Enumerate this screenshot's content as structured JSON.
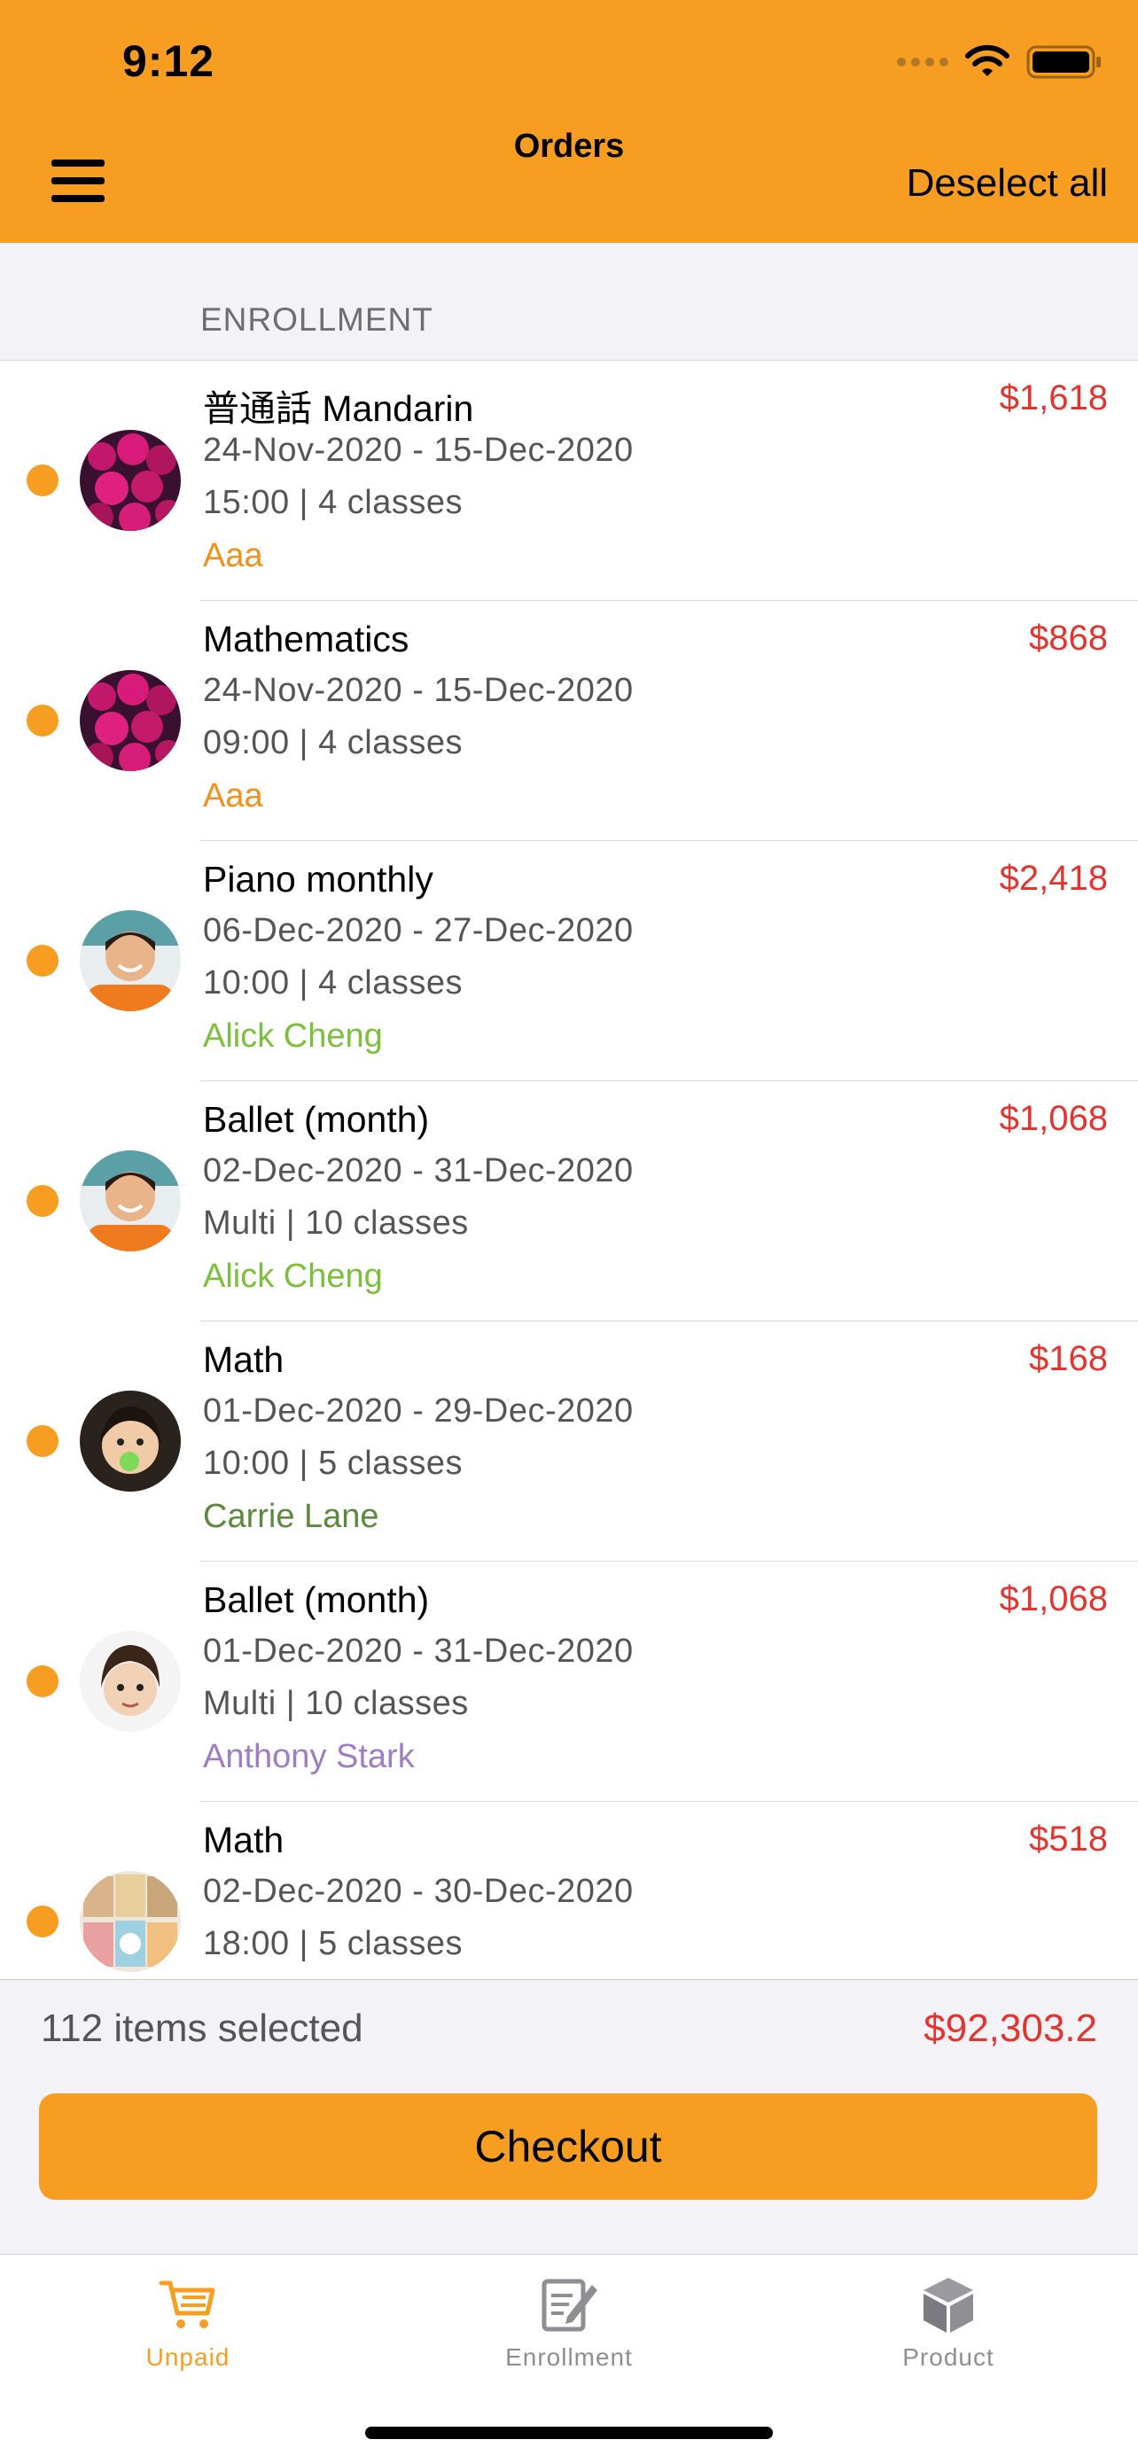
{
  "status_bar": {
    "time": "9:12"
  },
  "nav": {
    "title": "Orders",
    "deselect_label": "Deselect all"
  },
  "section": {
    "title": "ENROLLMENT"
  },
  "orders": [
    {
      "title": "普通話 Mandarin",
      "price": "$1,618",
      "dates": "24-Nov-2020  -  15-Dec-2020",
      "schedule": "15:00  |  4 classes",
      "student": "Aaa",
      "student_color": "#f0901e"
    },
    {
      "title": "Mathematics",
      "price": "$868",
      "dates": "24-Nov-2020  -  15-Dec-2020",
      "schedule": "09:00  |  4 classes",
      "student": "Aaa",
      "student_color": "#f0901e"
    },
    {
      "title": "Piano monthly",
      "price": "$2,418",
      "dates": "06-Dec-2020  -  27-Dec-2020",
      "schedule": "10:00  |  4 classes",
      "student": "Alick Cheng",
      "student_color": "#7bbf3a"
    },
    {
      "title": "Ballet (month)",
      "price": "$1,068",
      "dates": "02-Dec-2020  -  31-Dec-2020",
      "schedule": "Multi  |  10 classes",
      "student": "Alick Cheng",
      "student_color": "#7bbf3a"
    },
    {
      "title": "Math",
      "price": "$168",
      "dates": "01-Dec-2020  -  29-Dec-2020",
      "schedule": "10:00  |  5 classes",
      "student": "Carrie Lane",
      "student_color": "#5c8a3c"
    },
    {
      "title": "Ballet (month)",
      "price": "$1,068",
      "dates": "01-Dec-2020  -  31-Dec-2020",
      "schedule": "Multi  |  10 classes",
      "student": "Anthony Stark",
      "student_color": "#a07cc0"
    },
    {
      "title": "Math",
      "price": "$518",
      "dates": "02-Dec-2020  -  30-Dec-2020",
      "schedule": "18:00  |  5 classes",
      "student": "",
      "student_color": "#555555"
    }
  ],
  "summary": {
    "selected": "112 items selected",
    "total": "$92,303.2",
    "checkout_label": "Checkout"
  },
  "tabs": [
    {
      "label": "Unpaid",
      "icon": "cart-icon",
      "active": true
    },
    {
      "label": "Enrollment",
      "icon": "edit-document-icon",
      "active": false
    },
    {
      "label": "Product",
      "icon": "box-icon",
      "active": false
    }
  ],
  "colors": {
    "accent": "#f79e22",
    "price": "#e5342f",
    "inactive_tab": "#8e8e93"
  }
}
